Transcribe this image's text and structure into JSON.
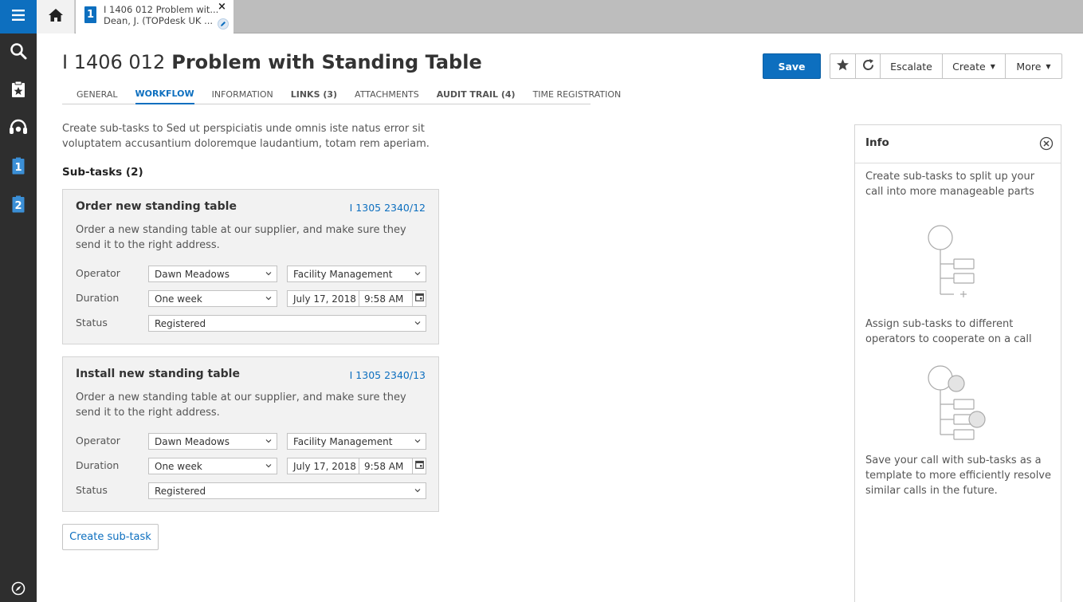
{
  "sidebar": {
    "items": [
      {
        "icon": "menu-icon"
      },
      {
        "icon": "search-icon"
      },
      {
        "icon": "clipboard-star-icon"
      },
      {
        "icon": "headset-icon"
      },
      {
        "icon": "card-1-icon",
        "label": "1"
      },
      {
        "icon": "card-2-icon",
        "label": "2"
      },
      {
        "icon": "compass-icon"
      }
    ]
  },
  "topbar": {
    "doc_tab": {
      "badge": "1",
      "line1": "I 1406 012 Problem wit...",
      "line2": "Dean, J.  (TOPdesk UK ...",
      "close": "×"
    }
  },
  "header": {
    "number": "I 1406 012",
    "name": "Problem with Standing Table",
    "save_label": "Save",
    "actions": {
      "escalate": "Escalate",
      "create": "Create",
      "more": "More"
    }
  },
  "tabs": [
    {
      "label": "GENERAL"
    },
    {
      "label": "WORKFLOW"
    },
    {
      "label": "INFORMATION"
    },
    {
      "label": "LINKS (3)"
    },
    {
      "label": "ATTACHMENTS"
    },
    {
      "label": "AUDIT TRAIL (4)"
    },
    {
      "label": "TIME REGISTRATION"
    }
  ],
  "main": {
    "intro": "Create sub-tasks to Sed ut perspiciatis unde omnis iste natus error sit voluptatem accusantium doloremque laudantium, totam rem aperiam.",
    "subtasks_heading": "Sub-tasks (2)",
    "labels": {
      "operator": "Operator",
      "duration": "Duration",
      "status": "Status"
    },
    "subtasks": [
      {
        "title": "Order new standing table",
        "id": "I 1305 2340/12",
        "description": "Order a new standing table at our supplier, and make sure they send it to the right address.",
        "operator": "Dawn Meadows",
        "group": "Facility Management",
        "duration": "One week",
        "date": "July 17, 2018",
        "time": "9:58 AM",
        "status": "Registered"
      },
      {
        "title": "Install new standing table",
        "id": "I 1305 2340/13",
        "description": "Order a new standing table at our supplier, and make sure they send it to the right address.",
        "operator": "Dawn Meadows",
        "group": "Facility Management",
        "duration": "One week",
        "date": "July 17, 2018",
        "time": "9:58 AM",
        "status": "Registered"
      }
    ],
    "create_subtask_label": "Create sub-task"
  },
  "info": {
    "title": "Info",
    "text1": "Create sub-tasks to split up your call into more manageable parts",
    "text2": "Assign sub-tasks to different operators to cooperate on a call",
    "text3": "Save your call with sub-tasks as a template to more efficiently resolve similar calls in the future."
  },
  "colors": {
    "accent": "#0d6fbf",
    "sidebar_bg": "#2e2e2e",
    "card_bg": "#f2f2f2"
  }
}
